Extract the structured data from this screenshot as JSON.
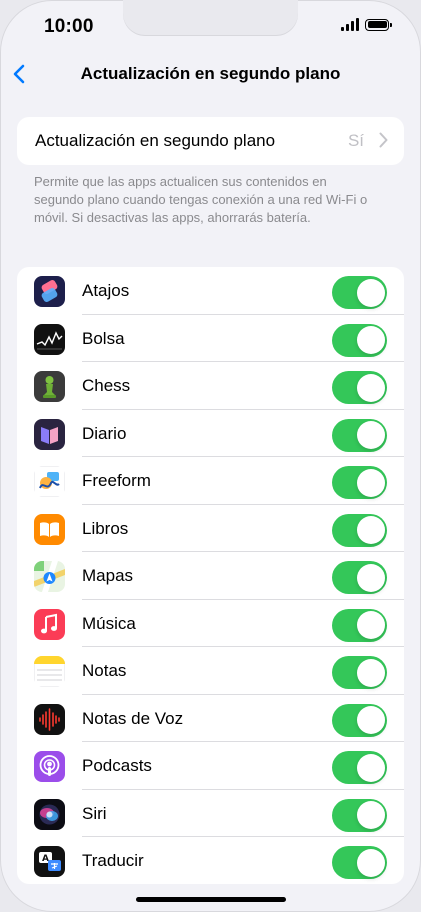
{
  "status_bar": {
    "time": "10:00"
  },
  "navbar": {
    "title": "Actualización en segundo plano",
    "back_icon": "chevron-left-icon"
  },
  "setting": {
    "label": "Actualización en segundo plano",
    "value": "Sí"
  },
  "footer_note": "Permite que las apps actualicen sus contenidos en segundo plano cuando tengas conexión a una red Wi-Fi o móvil. Si desactivas las apps, ahorrarás batería.",
  "colors": {
    "accent": "#007aff",
    "toggle_on": "#34c759",
    "background": "#f2f2f7"
  },
  "apps": [
    {
      "name": "Atajos",
      "icon": "shortcuts-icon",
      "enabled": true
    },
    {
      "name": "Bolsa",
      "icon": "stocks-icon",
      "enabled": true
    },
    {
      "name": "Chess",
      "icon": "chess-icon",
      "enabled": true
    },
    {
      "name": "Diario",
      "icon": "journal-icon",
      "enabled": true
    },
    {
      "name": "Freeform",
      "icon": "freeform-icon",
      "enabled": true
    },
    {
      "name": "Libros",
      "icon": "books-icon",
      "enabled": true
    },
    {
      "name": "Mapas",
      "icon": "maps-icon",
      "enabled": true
    },
    {
      "name": "Música",
      "icon": "music-icon",
      "enabled": true
    },
    {
      "name": "Notas",
      "icon": "notes-icon",
      "enabled": true
    },
    {
      "name": "Notas de Voz",
      "icon": "voice-memos-icon",
      "enabled": true
    },
    {
      "name": "Podcasts",
      "icon": "podcasts-icon",
      "enabled": true
    },
    {
      "name": "Siri",
      "icon": "siri-icon",
      "enabled": true
    },
    {
      "name": "Traducir",
      "icon": "translate-icon",
      "enabled": true
    }
  ]
}
